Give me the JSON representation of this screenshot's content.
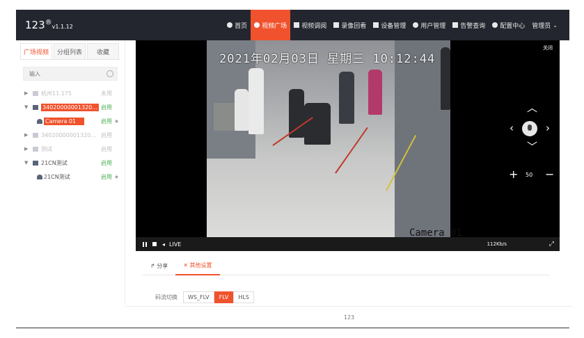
{
  "app": {
    "logo": "123",
    "logo_mark": "®",
    "version": "v1.1.12"
  },
  "nav": [
    {
      "label": "首页",
      "icon": "home-icon"
    },
    {
      "label": "视频广场",
      "icon": "play-icon",
      "active": true
    },
    {
      "label": "视频调阅",
      "icon": "grid-icon"
    },
    {
      "label": "录像回看",
      "icon": "record-icon"
    },
    {
      "label": "设备管理",
      "icon": "device-icon"
    },
    {
      "label": "用户管理",
      "icon": "user-icon"
    },
    {
      "label": "告警查询",
      "icon": "alarm-icon"
    },
    {
      "label": "配置中心",
      "icon": "gear-icon"
    }
  ],
  "user": {
    "label": "管理员"
  },
  "sidebar": {
    "tabs": [
      "广场视频",
      "分组列表",
      "收藏"
    ],
    "search_placeholder": "输入",
    "tree": [
      {
        "label": "杭州11.175",
        "status": "未用",
        "dim": true
      },
      {
        "label": "34020000001320...",
        "status": "启用",
        "highlight": true
      },
      {
        "label": "Camera 01",
        "status": "启用",
        "child": true,
        "highlight": true
      },
      {
        "label": "34020000001320...",
        "status": "启用",
        "dim": true
      },
      {
        "label": "测试",
        "status": "启用",
        "dim": true
      },
      {
        "label": "21CN测试",
        "status": "启用"
      },
      {
        "label": "21CN测试",
        "status": "启用",
        "child": true
      }
    ]
  },
  "video": {
    "osd_time": "2021年02月03日 星期三 10:12:44",
    "osd_camera": "Camera 01",
    "close_label": "关闭",
    "zoom_value": "50",
    "live_label": "LIVE",
    "bitrate": "112Kb/s"
  },
  "settings": {
    "tabs": [
      "分享",
      "其他设置"
    ],
    "stream_label": "码流切换",
    "stream_options": [
      "WS_FLV",
      "FLV",
      "HLS"
    ],
    "stream_selected": "FLV"
  },
  "footer": {
    "text": "123"
  }
}
